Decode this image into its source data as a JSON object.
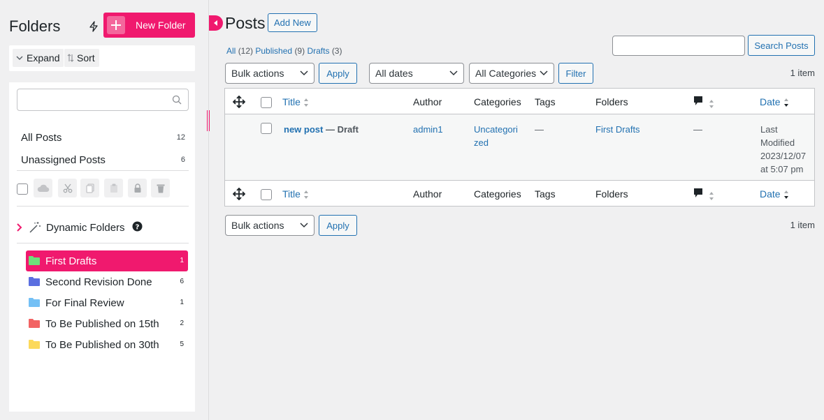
{
  "sidebar": {
    "title": "Folders",
    "new_folder_label": "New Folder",
    "expand_label": "Expand",
    "sort_label": "Sort",
    "search_placeholder": "",
    "all_posts": {
      "label": "All Posts",
      "count": "12"
    },
    "unassigned": {
      "label": "Unassigned Posts",
      "count": "6"
    },
    "dynamic_folders_label": "Dynamic Folders",
    "folders": [
      {
        "name": "First Drafts",
        "count": "1",
        "color": "#6ee07a",
        "active": true
      },
      {
        "name": "Second Revision Done",
        "count": "6",
        "color": "#5b6fe0"
      },
      {
        "name": "For Final Review",
        "count": "1",
        "color": "#74c0f5"
      },
      {
        "name": "To Be Published on 15th",
        "count": "2",
        "color": "#f26363"
      },
      {
        "name": "To Be Published on 30th",
        "count": "5",
        "color": "#fcd95b"
      }
    ],
    "accent_color": "#f0196e"
  },
  "main": {
    "title": "Posts",
    "add_new_label": "Add New",
    "filters": {
      "all": "All",
      "all_count": "(12)",
      "published": "Published",
      "published_count": "(9)",
      "drafts": "Drafts",
      "drafts_count": "(3)"
    },
    "search_button": "Search Posts",
    "bulk_actions": "Bulk actions",
    "apply": "Apply",
    "all_dates": "All dates",
    "all_categories": "All Categories",
    "filter": "Filter",
    "item_count": "1 item",
    "columns": {
      "title": "Title",
      "author": "Author",
      "categories": "Categories",
      "tags": "Tags",
      "folders": "Folders",
      "date": "Date"
    },
    "rows": [
      {
        "title": "new post",
        "state": "— Draft",
        "author": "admin1",
        "categories_line1": "Uncategori",
        "categories_line2": "zed",
        "tags": "—",
        "folders": "First Drafts",
        "comments": "—",
        "date_line1": "Last",
        "date_line2": "Modified",
        "date_line3": "2023/12/07",
        "date_line4": "at 5:07 pm"
      }
    ]
  }
}
